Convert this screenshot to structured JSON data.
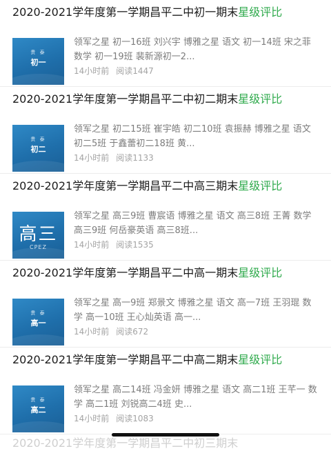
{
  "articles": [
    {
      "title_main": "2020-2021学年度第一学期昌平二中初一期末",
      "title_highlight": "星级评比",
      "summary": "领军之星 初一16班 刘兴宇 博雅之星 语文 初一14班 宋之菲 数学 初一19班 裴新源初一2...",
      "time": "14小时前",
      "reads": "阅读1447",
      "thumb_deco": "贵 泰",
      "thumb_text": "初一",
      "thumb_sub": ""
    },
    {
      "title_main": "2020-2021学年度第一学期昌平二中初二期末",
      "title_highlight": "星级评比",
      "summary": "领军之星 初二15班 崔宇皓 初二10班 袁振赫 博雅之星 语文 初二5班 于鑫蕾初二18班 黄...",
      "time": "14小时前",
      "reads": "阅读1133",
      "thumb_deco": "贵 泰",
      "thumb_text": "初二",
      "thumb_sub": ""
    },
    {
      "title_main": "2020-2021学年度第一学期昌平二中高三期末",
      "title_highlight": "星级评比",
      "summary": "领军之星 高三9班 曹宸语 博雅之星 语文 高三8班 王菁 数学 高三9班 何岳豪英语 高三8班...",
      "time": "14小时前",
      "reads": "阅读1535",
      "thumb_deco": "",
      "thumb_text": "高三",
      "thumb_sub": "CPEZ"
    },
    {
      "title_main": "2020-2021学年度第一学期昌平二中高一期末",
      "title_highlight": "星级评比",
      "summary": "领军之星 高一9班 郑景文 博雅之星 语文 高一7班 王羽琨 数学 高一10班 王心灿英语 高一...",
      "time": "14小时前",
      "reads": "阅读672",
      "thumb_deco": "贵 泰",
      "thumb_text": "高一",
      "thumb_sub": ""
    },
    {
      "title_main": "2020-2021学年度第一学期昌平二中高二期末",
      "title_highlight": "星级评比",
      "summary": "领军之星 高二14班 冯金妍 博雅之星 语文 高二1班 王芊一 数学 高二1班 刘锐高二4班 史...",
      "time": "14小时前",
      "reads": "阅读1083",
      "thumb_deco": "贵 泰",
      "thumb_text": "高二",
      "thumb_sub": ""
    }
  ],
  "next_partial_title": "2020-2021学年度第一学期昌平二中初三期末"
}
